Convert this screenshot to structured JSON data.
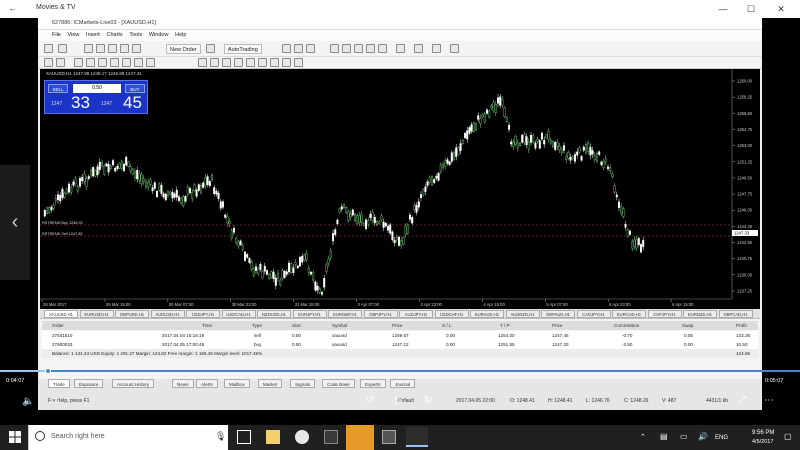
{
  "window": {
    "title": "Movies & TV",
    "minimize_glyph": "—",
    "maximize_glyph": "☐",
    "close_glyph": "✕",
    "prev_glyph": "‹"
  },
  "mt4": {
    "title": "627886: ICMarkets-Live03 - [XAUUSD,H1]",
    "menu": [
      "File",
      "View",
      "Insert",
      "Charts",
      "Tools",
      "Window",
      "Help"
    ],
    "new_order": "New Order",
    "auto_trading": "AutoTrading",
    "chart_header": "XAUUSD,H1  1247.99 1248.17 1246.89 1247.31",
    "trade_panel": {
      "sell_label": "SELL",
      "lot_value": "0.50",
      "buy_label": "BUY",
      "sell_prefix": "1247",
      "sell_big": "33",
      "buy_prefix": "1247",
      "buy_big": "45"
    },
    "level_labels": [
      "RSTREND Buy 1248.92",
      "RSTREND Sell 1247.85"
    ],
    "price_scale": [
      "1260.00",
      "1258.25",
      "1256.50",
      "1254.75",
      "1253.00",
      "1251.25",
      "1249.50",
      "1247.75",
      "1246.00",
      "1244.25",
      "1242.50",
      "1240.75",
      "1239.00",
      "1237.25"
    ],
    "current_price": "1247.33",
    "time_labels": [
      "28 Mar 2017",
      "29 Mar 15:00",
      "30 Mar 07:00",
      "30 Mar 23:00",
      "31 Mar 15:00",
      "3 Apr 07:00",
      "3 Apr 23:00",
      "4 Apr 15:00",
      "5 Apr 07:00",
      "5 Apr 23:00",
      "6 Apr 15:00"
    ],
    "symbol_tabs": [
      "XAUUSD,H1",
      "EURUSD,H1",
      "GBPUSD,H1",
      "AUDUSD,H1",
      "USDJPY,H1",
      "USDCAD,H1",
      "NZDUSD,H1",
      "EURJPY,H1",
      "EURGBP,H1",
      "GBPJPY,H1",
      "AUDJPY,H1",
      "USDCHF,H1",
      "EURAUD,H1",
      "AUDNZD,H1",
      "GBPAUD,H1",
      "CADJPY,H1",
      "EURCAD,H1",
      "CHFJPY,H1",
      "EURNZD,H1",
      "GBPCAD,H1"
    ],
    "table_headers": [
      "Order",
      "Time",
      "Type",
      "Size",
      "Symbol",
      "Price",
      "S / L",
      "T / P",
      "Price",
      "Commission",
      "Swap",
      "Profit"
    ],
    "orders": [
      [
        "27541510",
        "2017.04.04 15:18:19",
        "sell",
        "0.50",
        "xauusd",
        "1259.67",
        "0.00",
        "1254.00",
        "1247.45",
        "-0.70",
        "0.05",
        "133.35"
      ],
      [
        "27600033",
        "2017.04.05 17:00:48",
        "buy",
        "0.50",
        "xauusd",
        "1247.12",
        "0.00",
        "1251.85",
        "1247.33",
        "-3.50",
        "0.00",
        "10.50"
      ]
    ],
    "balance_line": "Balance: 1 144.43 USD  Equity: 1 291.27  Margin: 124.82  Free margin: 1 166.45  Margin level: 1017.45%",
    "balance_profit": "124.85",
    "bottom_tabs": [
      "Trade",
      "Exposure",
      "Account History",
      "News",
      "Alerts",
      "Mailbox",
      "Market",
      "Signals",
      "Code Base",
      "Experts",
      "Journal"
    ],
    "status_help": "For Help, press F1",
    "status_default": "Default",
    "status_time": "2017.04.05 22:00",
    "status_o": "O: 1248.41",
    "status_h": "H: 1248.41",
    "status_l": "L: 1246.76",
    "status_c": "C: 1248.26",
    "status_v": "V: 487",
    "status_mem": "4431/1 kb"
  },
  "video": {
    "elapsed": "0:04:07",
    "remaining": "0:05:07",
    "progress": 0.06
  },
  "taskbar": {
    "search_placeholder": "Search right here",
    "lang": "ENG",
    "time": "9:56 PM",
    "date": "4/5/2017"
  }
}
